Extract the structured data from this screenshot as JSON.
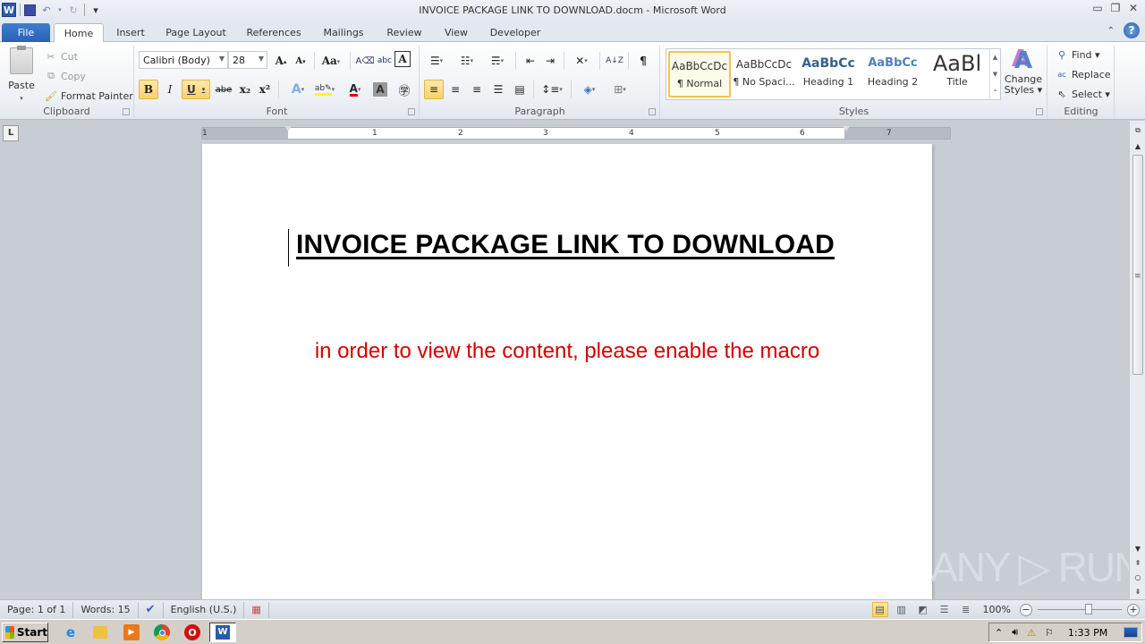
{
  "window": {
    "title": "INVOICE PACKAGE LINK TO DOWNLOAD.docm - Microsoft Word",
    "app_icon": "word-logo-icon",
    "controls": [
      "minimize-icon",
      "restore-icon",
      "close-icon"
    ]
  },
  "qat": {
    "app_glyph": "W",
    "save": "save-icon",
    "undo": "↶",
    "redo": "↻",
    "customize": "▾"
  },
  "tabs": [
    {
      "label": "File",
      "state": "file"
    },
    {
      "label": "Home",
      "state": "active"
    },
    {
      "label": "Insert"
    },
    {
      "label": "Page Layout"
    },
    {
      "label": "References"
    },
    {
      "label": "Mailings"
    },
    {
      "label": "Review"
    },
    {
      "label": "View"
    },
    {
      "label": "Developer"
    }
  ],
  "help": {
    "glyph": "?",
    "collapse_glyph": "⌃"
  },
  "clipboard": {
    "label": "Clipboard",
    "paste": "Paste",
    "cut": "Cut",
    "copy": "Copy",
    "format_painter": "Format Painter",
    "cut_enabled": false,
    "copy_enabled": false
  },
  "font": {
    "label": "Font",
    "family": "Calibri (Body)",
    "size": "28",
    "grow": "A",
    "shrink": "A",
    "change_case": "Aa",
    "bold": "B",
    "italic": "I",
    "underline": "U",
    "strike": "abe",
    "subscript": "x₂",
    "superscript": "x²",
    "bold_active": true,
    "underline_active": true,
    "highlight_color": "#ffff00",
    "font_color": "#e00000"
  },
  "paragraph": {
    "label": "Paragraph",
    "align": "left",
    "show_marks": "¶",
    "sort": "A↓Z"
  },
  "styles": {
    "label": "Styles",
    "items": [
      {
        "sample": "AaBbCcDc",
        "name": "¶ Normal",
        "selected": true
      },
      {
        "sample": "AaBbCcDc",
        "name": "¶ No Spaci..."
      },
      {
        "sample": "AaBbCc",
        "name": "Heading 1"
      },
      {
        "sample": "AaBbCc",
        "name": "Heading 2"
      },
      {
        "sample": "AaBl",
        "name": "Title"
      }
    ],
    "change_styles": "Change Styles",
    "change_styles_line1": "Change",
    "change_styles_line2": "Styles ▾"
  },
  "editing": {
    "label": "Editing",
    "find": "Find ▾",
    "replace": "Replace",
    "select": "Select ▾"
  },
  "ruler": {
    "tab_selector": "L",
    "numbers": [
      "1",
      "1",
      "2",
      "3",
      "4",
      "5",
      "6",
      "7"
    ]
  },
  "document": {
    "title": "INVOICE PACKAGE LINK TO DOWNLOAD",
    "body": "in order to view the content, please enable the macro",
    "title_color": "#000000",
    "body_color": "#d40000"
  },
  "watermark": "ANY ▷ RUN",
  "statusbar": {
    "page": "Page: 1 of 1",
    "words": "Words: 15",
    "language": "English (U.S.)",
    "zoom": "100%",
    "zoom_percent": 100,
    "view_mode": "print-layout"
  },
  "taskbar": {
    "start": "Start",
    "apps": [
      "internet-explorer-icon",
      "file-explorer-icon",
      "media-player-icon",
      "chrome-icon",
      "opera-icon",
      "word-icon"
    ],
    "active_app": "word",
    "clock": "1:33 PM"
  }
}
